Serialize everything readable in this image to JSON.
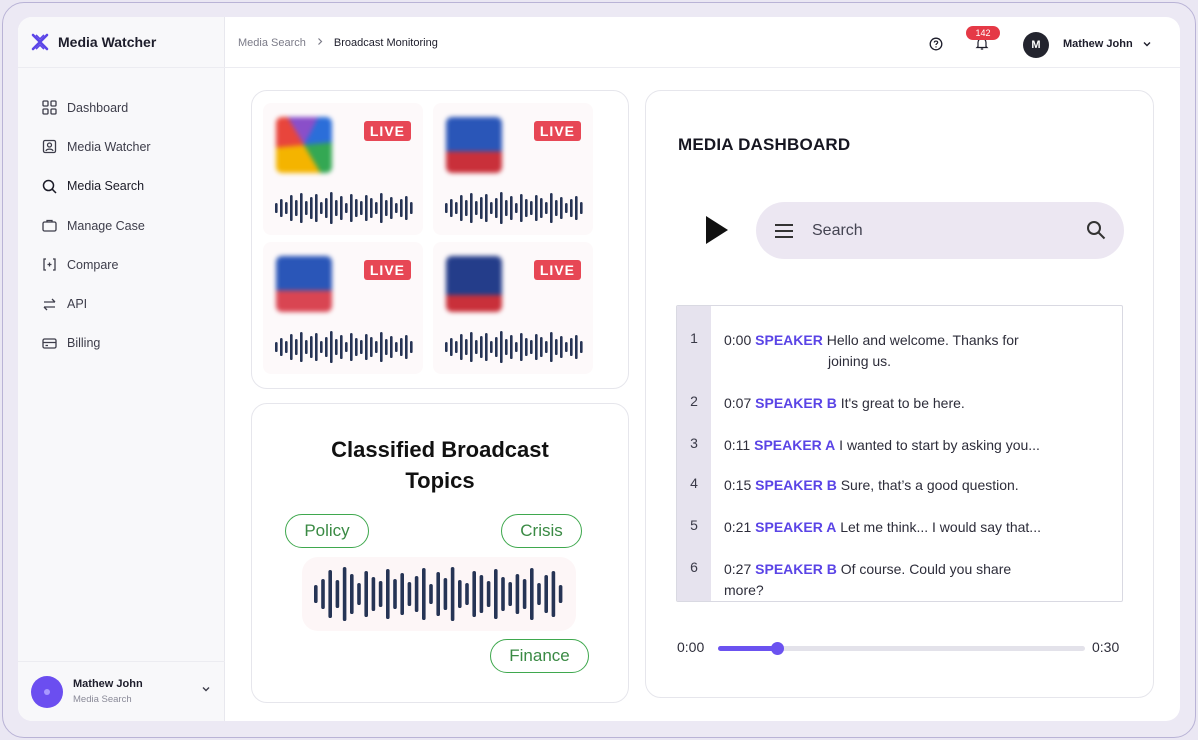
{
  "brand": {
    "name": "Media Watcher"
  },
  "sidebar": {
    "items": [
      {
        "label": "Dashboard",
        "icon": "dashboard-icon"
      },
      {
        "label": "Media Watcher",
        "icon": "user-card-icon"
      },
      {
        "label": "Media Search",
        "icon": "search-icon"
      },
      {
        "label": "Manage Case",
        "icon": "briefcase-icon"
      },
      {
        "label": "Compare",
        "icon": "compare-icon"
      },
      {
        "label": "API",
        "icon": "swap-arrows-icon"
      },
      {
        "label": "Billing",
        "icon": "card-icon"
      }
    ],
    "active": "Media Search",
    "user": {
      "name": "Mathew John",
      "role": "Media Search"
    }
  },
  "header": {
    "breadcrumb": [
      "Media Search",
      "Broadcast Monitoring"
    ],
    "notifications_count": "142",
    "user": {
      "initial": "M",
      "name": "Mathew John"
    }
  },
  "streams": [
    {
      "badge": "LIVE",
      "channel_icon": "nbc-peacock-logo"
    },
    {
      "badge": "LIVE",
      "channel_icon": "fox-news-logo"
    },
    {
      "badge": "LIVE",
      "channel_icon": "abc-news-logo"
    },
    {
      "badge": "LIVE",
      "channel_icon": "cnn-logo"
    }
  ],
  "topics": {
    "title": "Classified Broadcast Topics",
    "tags": [
      "Policy",
      "Crisis",
      "Finance"
    ],
    "tag_color": "#3fa84e"
  },
  "dashboard": {
    "title": "MEDIA DASHBOARD",
    "search_placeholder": "Search",
    "transcript": [
      {
        "n": "1",
        "time": "0:00",
        "speaker": "SPEAKER",
        "text": "Hello and welcome. Thanks for",
        "cont": "joining us."
      },
      {
        "n": "2",
        "time": "0:07",
        "speaker": "SPEAKER B",
        "text": "It's great to be here."
      },
      {
        "n": "3",
        "time": "0:11",
        "speaker": "SPEAKER A",
        "text": "I wanted to start by asking you..."
      },
      {
        "n": "4",
        "time": "0:15",
        "speaker": "SPEAKER B",
        "text": "Sure, that’s a good question."
      },
      {
        "n": "5",
        "time": "0:21",
        "speaker": "SPEAKER A",
        "text": "Let me think... I would say that..."
      },
      {
        "n": "6",
        "time": "0:27",
        "speaker": "SPEAKER B",
        "text": "Of course. Could you share more?"
      }
    ],
    "player": {
      "start": "0:00",
      "end": "0:30",
      "progress": 0.16
    },
    "accent": "#5a44e6"
  },
  "colors": {
    "live_badge": "#e74755",
    "brand_purple": "#6b52f0",
    "wave": "#263455"
  }
}
